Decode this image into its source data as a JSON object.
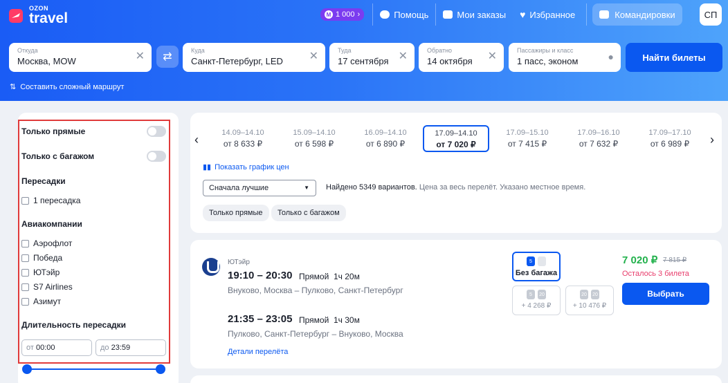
{
  "brand": {
    "top": "OZON",
    "bottom": "travel"
  },
  "header": {
    "cashback": "1 000",
    "nav": [
      {
        "label": "Помощь",
        "icon": "chat-icon"
      },
      {
        "label": "Мои заказы",
        "icon": "orders-icon"
      },
      {
        "label": "Избранное",
        "icon": "heart-icon"
      }
    ],
    "business": "Командировки",
    "avatar": "СП"
  },
  "search": {
    "from": {
      "label": "Откуда",
      "value": "Москва, MOW"
    },
    "to": {
      "label": "Куда",
      "value": "Санкт-Петербург, LED"
    },
    "depart": {
      "label": "Туда",
      "value": "17 сентября"
    },
    "return": {
      "label": "Обратно",
      "value": "14 октября"
    },
    "passengers": {
      "label": "Пассажиры и класс",
      "value": "1 пасс, эконом"
    },
    "find_button": "Найти билеты",
    "complex_route": "Составить сложный маршрут"
  },
  "filters": {
    "direct_only": "Только прямые",
    "with_baggage": "Только с багажом",
    "transfers_title": "Пересадки",
    "transfers": [
      "1 пересадка"
    ],
    "airlines_title": "Авиакомпании",
    "airlines": [
      "Аэрофлот",
      "Победа",
      "ЮТэйр",
      "S7 Airlines",
      "Азимут"
    ],
    "duration_title": "Длительность пересадки",
    "from_prefix": "от",
    "from_value": "00:00",
    "to_prefix": "до",
    "to_value": "23:59"
  },
  "dates": [
    {
      "range": "14.09–14.10",
      "price": "от 8 633 ₽"
    },
    {
      "range": "15.09–14.10",
      "price": "от 6 598 ₽"
    },
    {
      "range": "16.09–14.10",
      "price": "от 6 890 ₽"
    },
    {
      "range": "17.09–14.10",
      "price": "от 7 020 ₽",
      "active": true
    },
    {
      "range": "17.09–15.10",
      "price": "от 7 415 ₽"
    },
    {
      "range": "17.09–16.10",
      "price": "от 7 632 ₽"
    },
    {
      "range": "17.09–17.10",
      "price": "от 6 989 ₽"
    }
  ],
  "results_bar": {
    "chart_link": "Показать график цен",
    "sort": "Сначала лучшие",
    "found": "Найдено 5349 вариантов.",
    "found_note": "Цена за весь перелёт. Указано местное время.",
    "chips": [
      "Только прямые",
      "Только с багажом"
    ]
  },
  "result": {
    "airline": "ЮТэйр",
    "outbound": {
      "time": "19:10 – 20:30",
      "type": "Прямой",
      "duration": "1ч 20м",
      "route": "Внуково, Москва – Пулково, Санкт-Петербург"
    },
    "inbound": {
      "time": "21:35 – 23:05",
      "type": "Прямой",
      "duration": "1ч 30м",
      "route": "Пулково, Санкт-Петербург – Внуково, Москва"
    },
    "details": "Детали перелёта",
    "tariffs": {
      "selected_label": "Без багажа",
      "opt1_add": "+ 4 268 ₽",
      "opt2_add": "+ 10 476 ₽",
      "bag_small": "5",
      "bag_big": "20"
    },
    "price": "7 020 ₽",
    "old_price": "7 815 ₽",
    "tickets_left": "Осталось 3 билета",
    "choose": "Выбрать"
  },
  "colors": {
    "brand_blue": "#0a58f0",
    "price_green": "#22b14c",
    "warning_pink": "#e83c6b",
    "highlight_red": "#e03a3a"
  }
}
